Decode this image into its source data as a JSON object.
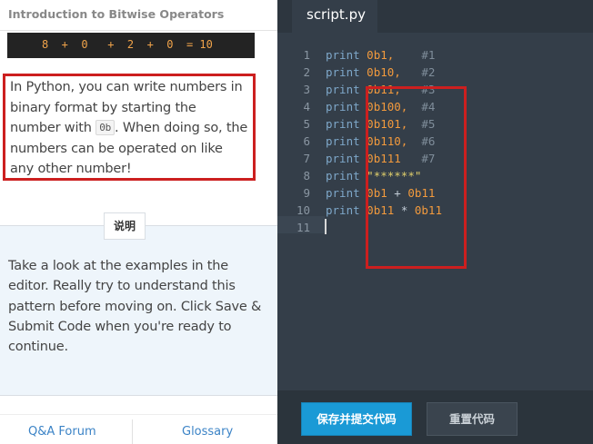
{
  "lesson": {
    "title": "Introduction to Bitwise Operators",
    "code_strip": "8  +  0   +  2  +  0  = 10",
    "paragraph_before": "In Python, you can write numbers in binary format by starting the number with ",
    "paragraph_code": "0b",
    "paragraph_after": ". When doing so, the numbers can be operated on like any other number!",
    "instructions_tab": "说明",
    "instructions": "Take a look at the examples in the editor. Really try to understand this pattern before moving on. Click Save & Submit Code when you're ready to continue."
  },
  "footer": {
    "qa_forum": "Q&A Forum",
    "glossary": "Glossary"
  },
  "editor": {
    "file_tab": "script.py",
    "line_numbers": [
      "1",
      "2",
      "3",
      "4",
      "5",
      "6",
      "7",
      "8",
      "9",
      "10",
      "11"
    ],
    "lines": [
      {
        "kw": "print",
        "val": "0b1,",
        "cmt": "#1"
      },
      {
        "kw": "print",
        "val": "0b10,",
        "cmt": "#2"
      },
      {
        "kw": "print",
        "val": "0b11,",
        "cmt": "#3"
      },
      {
        "kw": "print",
        "val": "0b100,",
        "cmt": "#4"
      },
      {
        "kw": "print",
        "val": "0b101,",
        "cmt": "#5"
      },
      {
        "kw": "print",
        "val": "0b110,",
        "cmt": "#6"
      },
      {
        "kw": "print",
        "val": "0b111",
        "cmt": "#7"
      },
      {
        "kw": "print",
        "str": "\"******\""
      },
      {
        "kw": "print",
        "a": "0b1",
        "op": "+",
        "b": "0b11"
      },
      {
        "kw": "print",
        "a": "0b11",
        "op": "*",
        "b": "0b11"
      }
    ]
  },
  "buttons": {
    "save_submit": "保存并提交代码",
    "reset_code": "重置代码"
  },
  "colors": {
    "highlight_border": "#cc1f1f",
    "primary_button": "#1a9ad6",
    "editor_bg": "#343e49"
  }
}
